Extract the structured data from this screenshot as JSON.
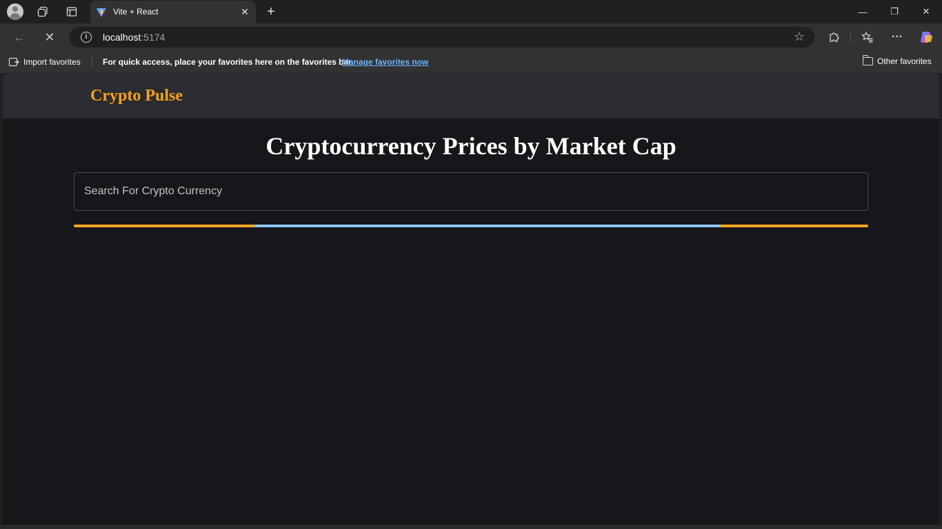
{
  "browser": {
    "tab": {
      "title": "Vite + React"
    },
    "address": {
      "host": "localhost",
      "port": ":5174"
    },
    "favorites_bar": {
      "import_label": "Import favorites",
      "hint": "For quick access, place your favorites here on the favorites bar.",
      "manage_link": "Manage favorites now",
      "other_label": "Other favorites"
    },
    "icons": {
      "new_tab": "+",
      "close_tab": "✕",
      "minimize": "—",
      "maximize": "❐",
      "close_window": "✕",
      "back": "←",
      "stop": "✕",
      "star": "☆",
      "more": "···"
    }
  },
  "app": {
    "brand": "Crypto Pulse",
    "title": "Cryptocurrency Prices by Market Cap",
    "search": {
      "placeholder": "Search For Crypto Currency",
      "value": ""
    },
    "colors": {
      "accent": "#f5a623",
      "progress_bar": "#8fc4f0",
      "background": "#16171b",
      "header": "#2b2c31"
    }
  }
}
